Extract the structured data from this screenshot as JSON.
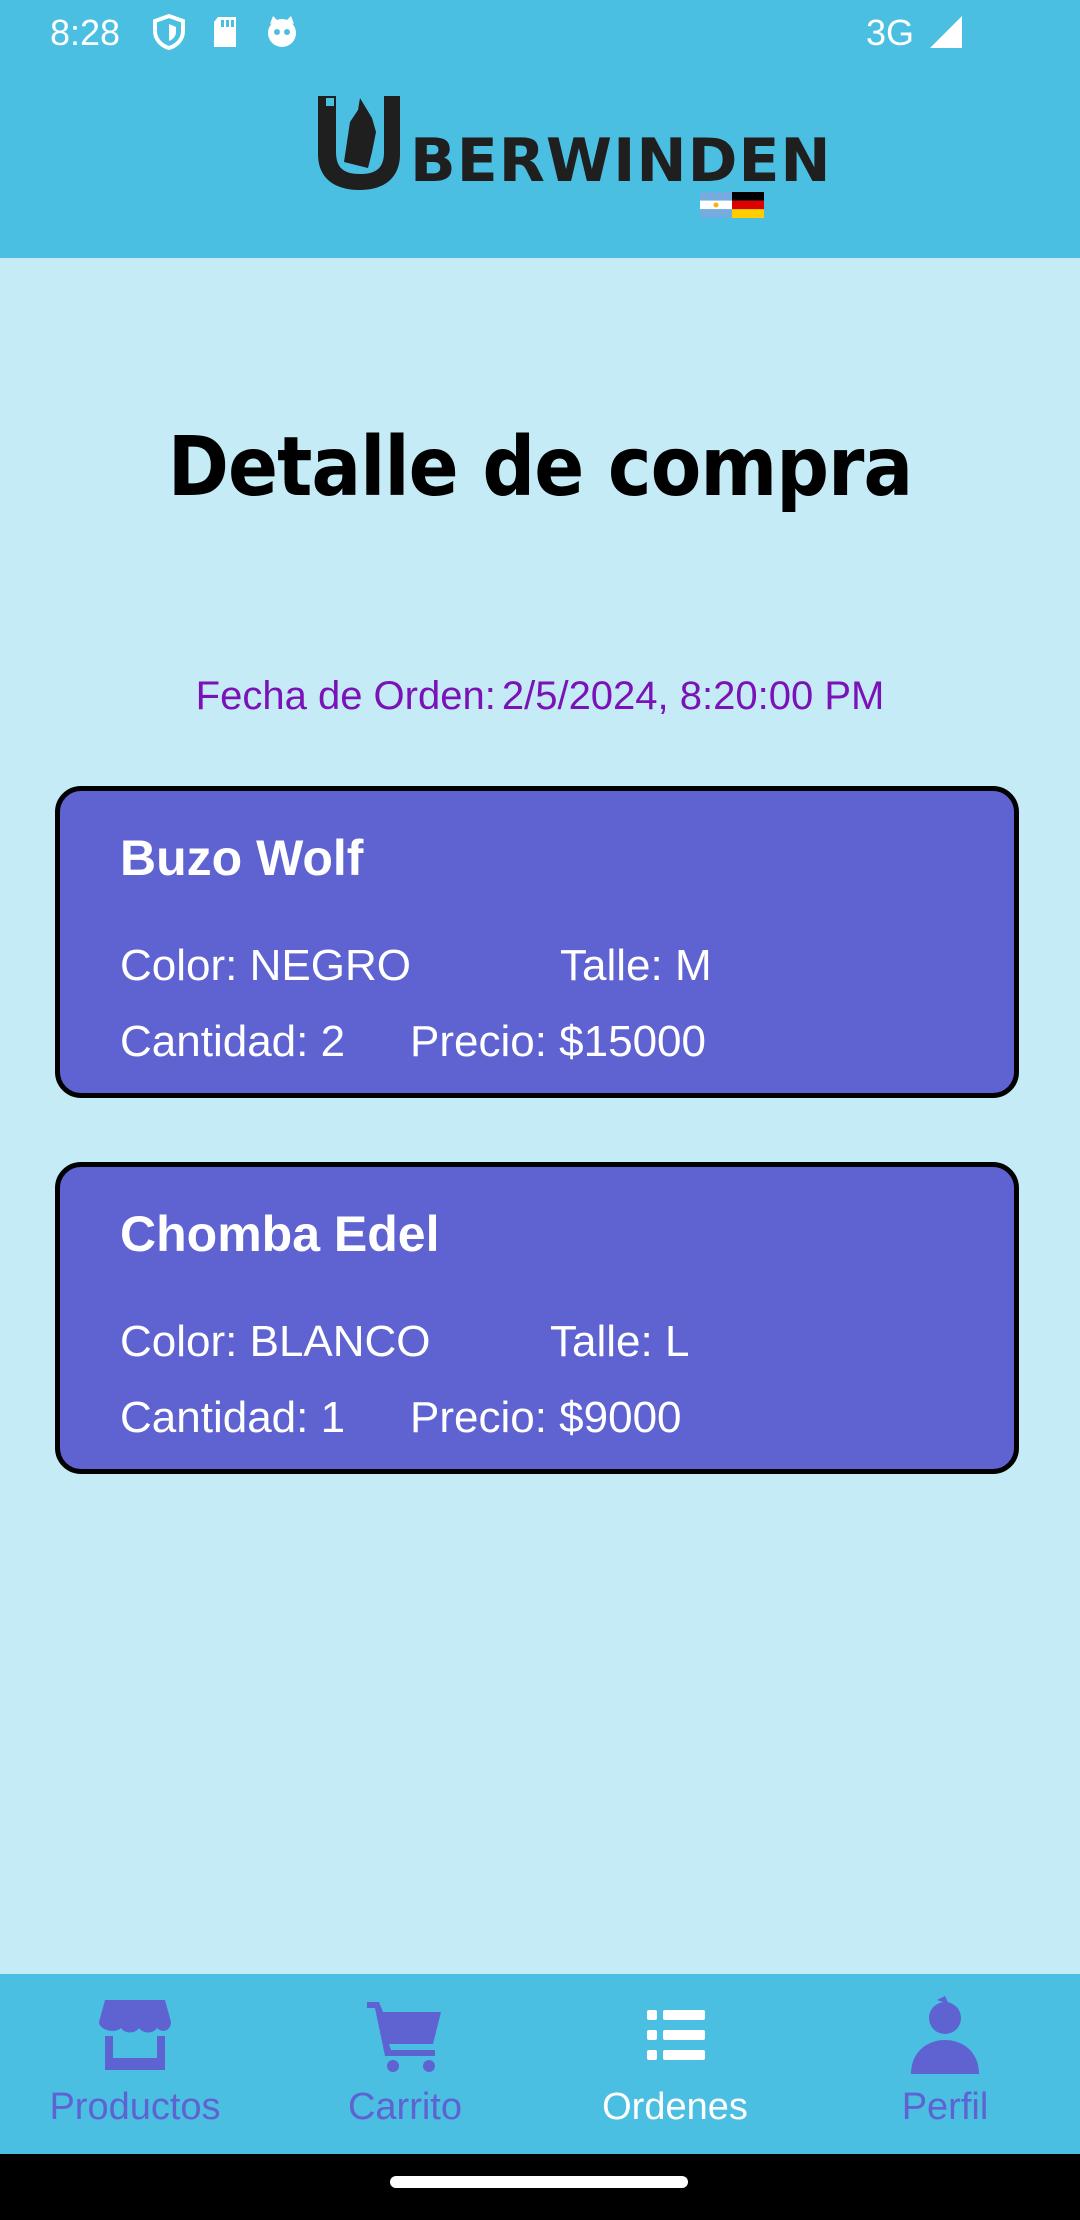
{
  "status_bar": {
    "time": "8:28",
    "network": "3G"
  },
  "header": {
    "logo_text": "BERWINDEN"
  },
  "main": {
    "title": "Detalle de compra",
    "order_date_label": "Fecha de Orden:",
    "order_date_value": "2/5/2024, 8:20:00 PM",
    "items": [
      {
        "name": "Buzo Wolf",
        "color_text": "Color: NEGRO",
        "size_text": "Talle: M",
        "qty_text": "Cantidad: 2",
        "price_text": "Precio: $15000"
      },
      {
        "name": "Chomba Edel",
        "color_text": "Color: BLANCO",
        "size_text": "Talle: L",
        "qty_text": "Cantidad: 1",
        "price_text": "Precio: $9000"
      }
    ]
  },
  "bottom_nav": {
    "items": [
      {
        "label": "Productos",
        "icon": "store-icon"
      },
      {
        "label": "Carrito",
        "icon": "cart-icon"
      },
      {
        "label": "Ordenes",
        "icon": "list-icon",
        "active": true
      },
      {
        "label": "Perfil",
        "icon": "user-icon"
      }
    ]
  },
  "colors": {
    "header_bg": "#4ABFE2",
    "page_bg": "#C5EBF7",
    "card_bg": "#5F63D1",
    "date_text": "#7A12B8",
    "nav_inactive": "#5F63D1"
  }
}
